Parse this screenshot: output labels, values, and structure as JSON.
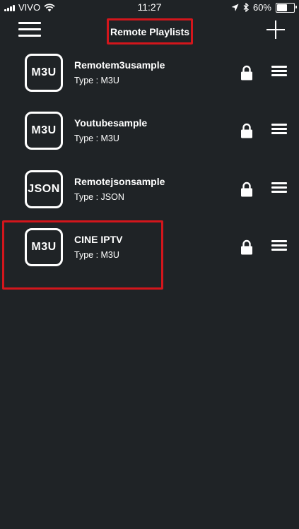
{
  "status_bar": {
    "carrier": "VIVO",
    "time": "11:27",
    "battery": "60%",
    "battery_level": 0.6
  },
  "header": {
    "title": "Remote Playlists"
  },
  "playlists": [
    {
      "badge": "M3U",
      "name": "Remotem3usample",
      "type": "Type : M3U"
    },
    {
      "badge": "M3U",
      "name": "Youtubesample",
      "type": "Type : M3U"
    },
    {
      "badge": "JSON",
      "name": "Remotejsonsample",
      "type": "Type : JSON"
    },
    {
      "badge": "M3U",
      "name": "CINE IPTV",
      "type": "Type : M3U"
    }
  ],
  "colors": {
    "background": "#1f2326",
    "highlight": "#d3161c",
    "foreground": "#ffffff"
  }
}
